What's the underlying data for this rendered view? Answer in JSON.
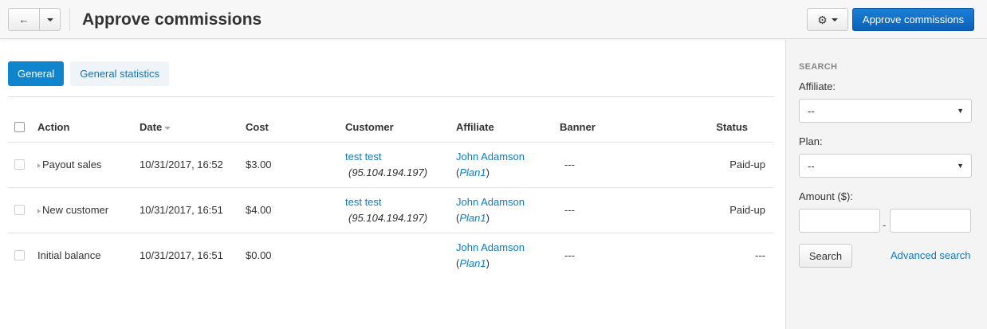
{
  "header": {
    "title": "Approve commissions",
    "back_icon": "←",
    "gear_icon": "⚙",
    "primary_button": "Approve commissions"
  },
  "tabs": [
    {
      "label": "General",
      "active": true
    },
    {
      "label": "General statistics",
      "active": false
    }
  ],
  "table": {
    "columns": {
      "action": "Action",
      "date": "Date",
      "cost": "Cost",
      "customer": "Customer",
      "affiliate": "Affiliate",
      "banner": "Banner",
      "status": "Status"
    },
    "rows": [
      {
        "action": "Payout sales",
        "date": "10/31/2017, 16:52",
        "cost": "$3.00",
        "customer_name": "test test",
        "customer_ip": "(95.104.194.197)",
        "affiliate": "John Adamson",
        "plan": "Plan1",
        "banner": "---",
        "status": "Paid-up"
      },
      {
        "action": "New customer",
        "date": "10/31/2017, 16:51",
        "cost": "$4.00",
        "customer_name": "test test",
        "customer_ip": "(95.104.194.197)",
        "affiliate": "John Adamson",
        "plan": "Plan1",
        "banner": "---",
        "status": "Paid-up"
      },
      {
        "action": "Initial balance",
        "date": "10/31/2017, 16:51",
        "cost": "$0.00",
        "customer_name": "",
        "customer_ip": "",
        "affiliate": "John Adamson",
        "plan": "Plan1",
        "banner": "---",
        "status": "---"
      }
    ]
  },
  "sidebar": {
    "title": "SEARCH",
    "affiliate_label": "Affiliate:",
    "affiliate_value": "--",
    "plan_label": "Plan:",
    "plan_value": "--",
    "amount_label": "Amount ($):",
    "amount_separator": "-",
    "select_arrow": "▼",
    "search_button": "Search",
    "advanced_link": "Advanced search"
  },
  "colors": {
    "primary": "#0a60b8",
    "tab_active": "#0e85cc",
    "link": "#0e7bc4"
  }
}
